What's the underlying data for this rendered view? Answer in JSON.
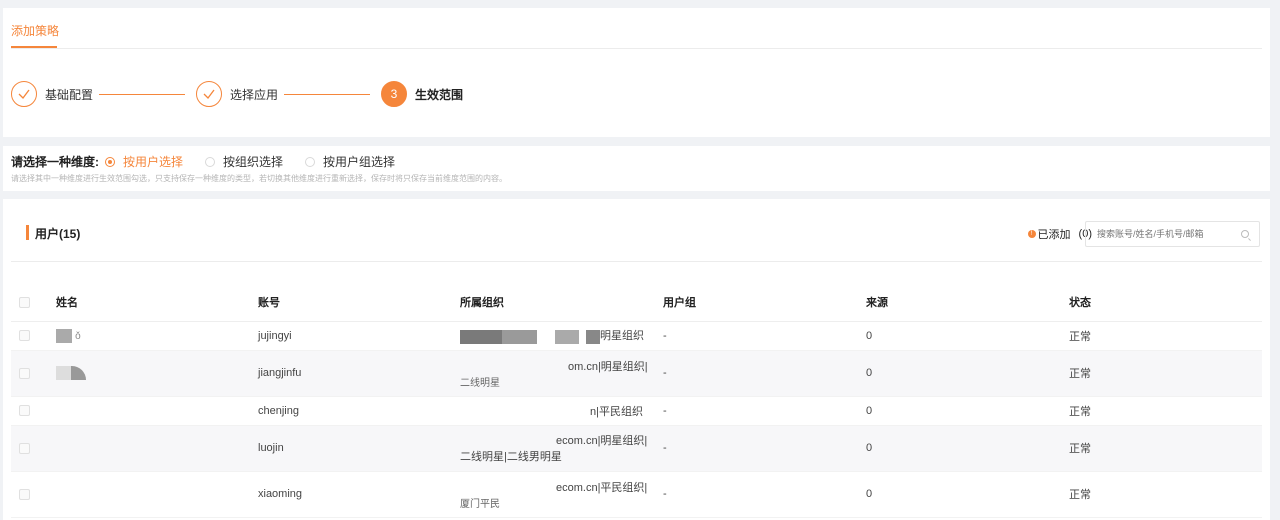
{
  "tab": {
    "label": "添加策略"
  },
  "steps": [
    {
      "label": "基础配置",
      "state": "done",
      "icon": "check-icon"
    },
    {
      "label": "选择应用",
      "state": "done",
      "icon": "check-icon"
    },
    {
      "label": "生效范围",
      "state": "active",
      "number": "3"
    }
  ],
  "dimension": {
    "title": "请选择一种维度:",
    "options": [
      "按用户选择",
      "按组织选择",
      "按用户组选择"
    ],
    "selected": "按用户选择",
    "hint": "请选择其中一种维度进行生效范围勾选，只支持保存一种维度的类型，若切换其他维度进行重新选择，保存时将只保存当前维度范围的内容。"
  },
  "users": {
    "title": "用户(15)",
    "added_label": "已添加",
    "added_count": "(0)",
    "search_placeholder": "搜索账号/姓名/手机号/邮箱",
    "columns": [
      "姓名",
      "账号",
      "所属组织",
      "用户组",
      "来源",
      "状态"
    ],
    "rows": [
      {
        "name": "ǒ",
        "account": "jujingyi",
        "org": "明星组织",
        "group": "-",
        "source": "0",
        "status": "正常"
      },
      {
        "name": "",
        "account": "jiangjinfu",
        "org": "om.cn|明星组织|",
        "org2": "二线明星",
        "group": "-",
        "source": "0",
        "status": "正常"
      },
      {
        "name": "",
        "account": "chenjing",
        "org": "n|平民组织",
        "group": "-",
        "source": "0",
        "status": "正常"
      },
      {
        "name": "",
        "account": "luojin",
        "org": "ecom.cn|明星组织|",
        "org2": "二线明星|二线男明星",
        "group": "-",
        "source": "0",
        "status": "正常"
      },
      {
        "name": "",
        "account": "xiaoming",
        "org": "ecom.cn|平民组织|",
        "org2": "厦门平民",
        "group": "-",
        "source": "0",
        "status": "正常"
      }
    ]
  },
  "colors": {
    "accent": "#f5863b"
  }
}
